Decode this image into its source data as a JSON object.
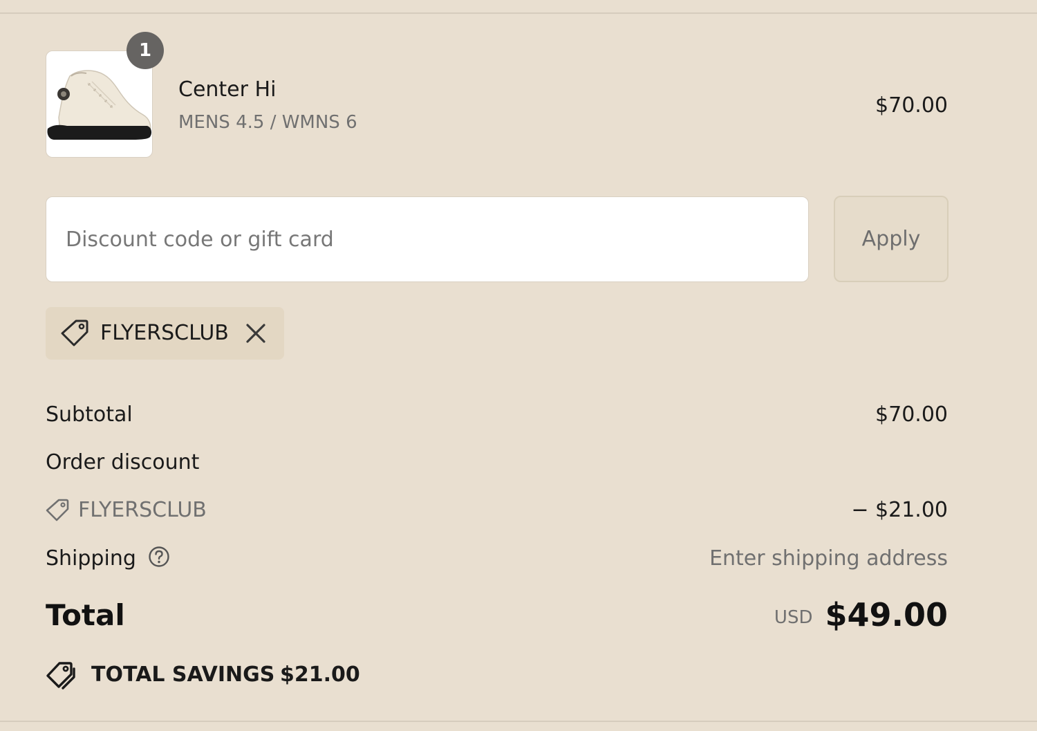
{
  "line_item": {
    "quantity": "1",
    "name": "Center Hi",
    "variant": "MENS 4.5 / WMNS 6",
    "price": "$70.00",
    "image_icon": "sneaker-icon"
  },
  "discount": {
    "placeholder": "Discount code or gift card",
    "value": "",
    "apply_label": "Apply",
    "applied_code": "FLYERSCLUB"
  },
  "summary": {
    "subtotal_label": "Subtotal",
    "subtotal_value": "$70.00",
    "order_discount_label": "Order discount",
    "discount_code": "FLYERSCLUB",
    "discount_value": "− $21.00",
    "shipping_label": "Shipping",
    "shipping_value": "Enter shipping address",
    "total_label": "Total",
    "total_currency": "USD",
    "total_value": "$49.00",
    "savings_label": "TOTAL SAVINGS",
    "savings_value": "$21.00"
  },
  "colors": {
    "background": "#e9dfd0",
    "chip": "#e3d7c3",
    "text": "#1a1a1a",
    "muted": "#707070",
    "badge": "#666462"
  }
}
